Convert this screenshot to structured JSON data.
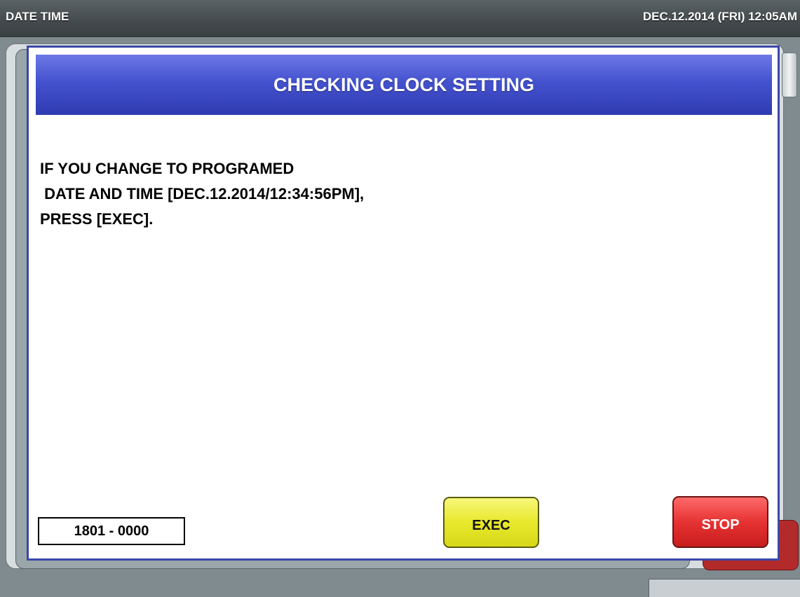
{
  "topbar": {
    "title": "DATE TIME",
    "datetime": "DEC.12.2014 (FRI)  12:05AM"
  },
  "dialog": {
    "header": "CHECKING CLOCK SETTING",
    "message_lines": [
      "IF YOU CHANGE TO PROGRAMED",
      " DATE AND TIME [DEC.12.2014/12:34:56PM],",
      "PRESS [EXEC]."
    ],
    "code": "1801 - 0000",
    "exec_label": "EXEC",
    "stop_label": "STOP"
  },
  "colors": {
    "header_blue": "#4452cf",
    "exec_yellow": "#e8e82c",
    "stop_red": "#e63232"
  }
}
